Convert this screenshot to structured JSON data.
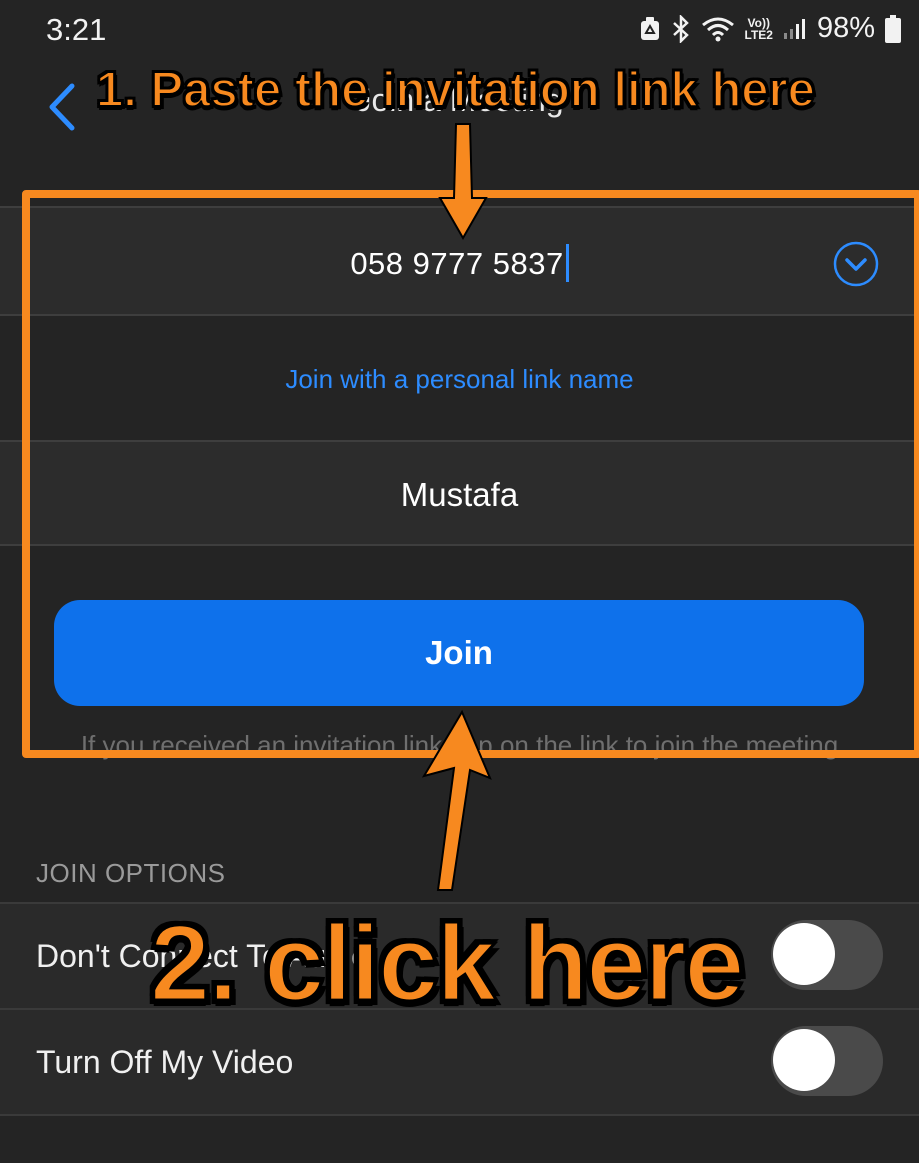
{
  "status_bar": {
    "time": "3:21",
    "volte_top": "Vo))",
    "volte_bottom": "LTE2",
    "battery": "98%"
  },
  "header": {
    "title": "Join a Meeting"
  },
  "form": {
    "meeting_id_value": "058 9777 5837",
    "personal_link_label": "Join with a personal link name",
    "name_value": "Mustafa",
    "join_label": "Join",
    "hint_text": "If you received an invitation link, tap on the link to join the meeting"
  },
  "join_options": {
    "header": "JOIN OPTIONS",
    "options": [
      {
        "label": "Don't Connect To Audio",
        "enabled": false
      },
      {
        "label": "Turn Off My Video",
        "enabled": false
      }
    ]
  },
  "annotations": {
    "step1": "1. Paste the invitation link here",
    "step2": "2. click here",
    "highlight_color": "#f7891f"
  },
  "colors": {
    "background": "#242424",
    "accent": "#0e71eb",
    "link": "#2d8cff"
  }
}
